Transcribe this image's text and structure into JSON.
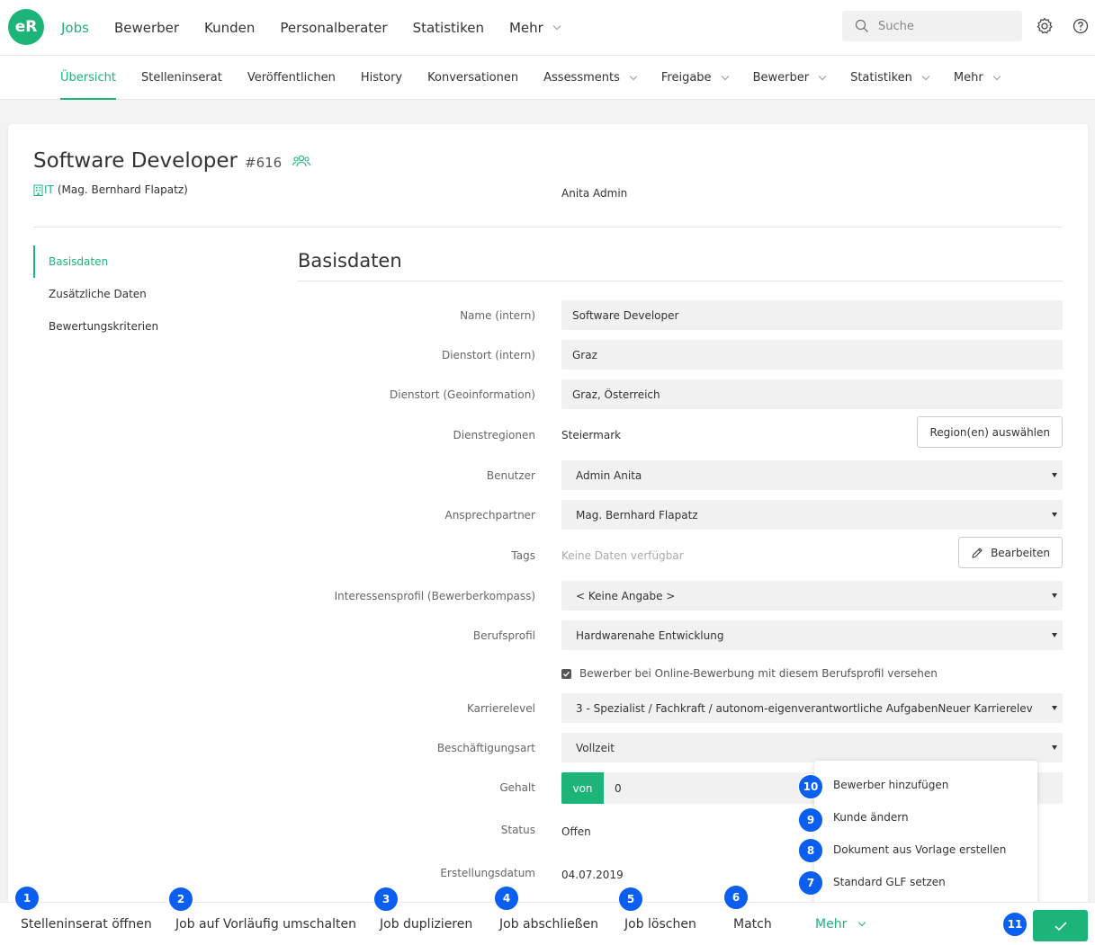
{
  "app": {
    "logo": "eR",
    "accent_color": "#1db47a",
    "badge_color": "#0a5ef0"
  },
  "topnav": {
    "items": [
      {
        "label": "Jobs",
        "active": true
      },
      {
        "label": "Bewerber"
      },
      {
        "label": "Kunden"
      },
      {
        "label": "Personalberater"
      },
      {
        "label": "Statistiken"
      },
      {
        "label": "Mehr",
        "has_dropdown": true
      }
    ],
    "search_placeholder": "Suche",
    "icons": [
      "search-icon",
      "gear-icon",
      "help-icon"
    ]
  },
  "subnav": {
    "items": [
      {
        "label": "Übersicht",
        "active": true
      },
      {
        "label": "Stelleninserat"
      },
      {
        "label": "Veröffentlichen"
      },
      {
        "label": "History"
      },
      {
        "label": "Konversationen"
      },
      {
        "label": "Assessments",
        "has_dropdown": true
      },
      {
        "label": "Freigabe",
        "has_dropdown": true
      },
      {
        "label": "Bewerber",
        "has_dropdown": true
      },
      {
        "label": "Statistiken",
        "has_dropdown": true
      },
      {
        "label": "Mehr",
        "has_dropdown": true
      }
    ]
  },
  "job": {
    "title": "Software Developer",
    "id": "#616",
    "department": "IT",
    "contact": "(Mag. Bernhard Flapatz)",
    "owner": "Anita Admin"
  },
  "sidenav": {
    "items": [
      {
        "label": "Basisdaten",
        "active": true
      },
      {
        "label": "Zusätzliche Daten"
      },
      {
        "label": "Bewertungskriterien"
      }
    ]
  },
  "form": {
    "section_title": "Basisdaten",
    "name": {
      "label": "Name (intern)",
      "value": "Software Developer"
    },
    "dienstort": {
      "label": "Dienstort (intern)",
      "value": "Graz"
    },
    "geo": {
      "label": "Dienstort (Geoinformation)",
      "value": "Graz, Österreich"
    },
    "regionen": {
      "label": "Dienstregionen",
      "value": "Steiermark",
      "button": "Region(en) auswählen"
    },
    "benutzer": {
      "label": "Benutzer",
      "value": "Admin Anita"
    },
    "ansprechpartner": {
      "label": "Ansprechpartner",
      "value": "Mag. Bernhard Flapatz"
    },
    "tags": {
      "label": "Tags",
      "value": "Keine Daten verfügbar",
      "button": "Bearbeiten"
    },
    "interessensprofil": {
      "label": "Interessensprofil (Bewerberkompass)",
      "value": "< Keine Angabe >"
    },
    "berufsprofil": {
      "label": "Berufsprofil",
      "value": "Hardwarenahe Entwicklung"
    },
    "checkbox": {
      "label": "Bewerber bei Online-Bewerbung mit diesem Berufsprofil versehen",
      "checked": true
    },
    "karrierelevel": {
      "label": "Karrierelevel",
      "value": "3 - Spezialist / Fachkraft / autonom-eigenverantwortliche AufgabenNeuer Karrierelev"
    },
    "beschaeftigungsart": {
      "label": "Beschäftigungsart",
      "value": "Vollzeit"
    },
    "gehalt": {
      "label": "Gehalt",
      "prefix": "von",
      "value": "0"
    },
    "status": {
      "label": "Status",
      "value": "Offen"
    },
    "erstellungsdatum": {
      "label": "Erstellungsdatum",
      "value": "04.07.2019"
    }
  },
  "more_menu": {
    "items": [
      {
        "label": "Bewerber hinzufügen",
        "badge": "10"
      },
      {
        "label": "Kunde ändern",
        "badge": "9"
      },
      {
        "label": "Dokument aus Vorlage erstellen",
        "badge": "8"
      },
      {
        "label": "Standard GLF setzen",
        "badge": "7"
      }
    ]
  },
  "actions": {
    "items": [
      {
        "label": "Stelleninserat öffnen",
        "badge": "1"
      },
      {
        "label": "Job auf Vorläufig umschalten",
        "badge": "2"
      },
      {
        "label": "Job duplizieren",
        "badge": "3"
      },
      {
        "label": "Job abschließen",
        "badge": "4"
      },
      {
        "label": "Job löschen",
        "badge": "5"
      },
      {
        "label": "Match",
        "badge": "6"
      },
      {
        "label": "Mehr"
      }
    ],
    "confirm_badge": "11",
    "confirm_icon": "checkmark-icon"
  }
}
